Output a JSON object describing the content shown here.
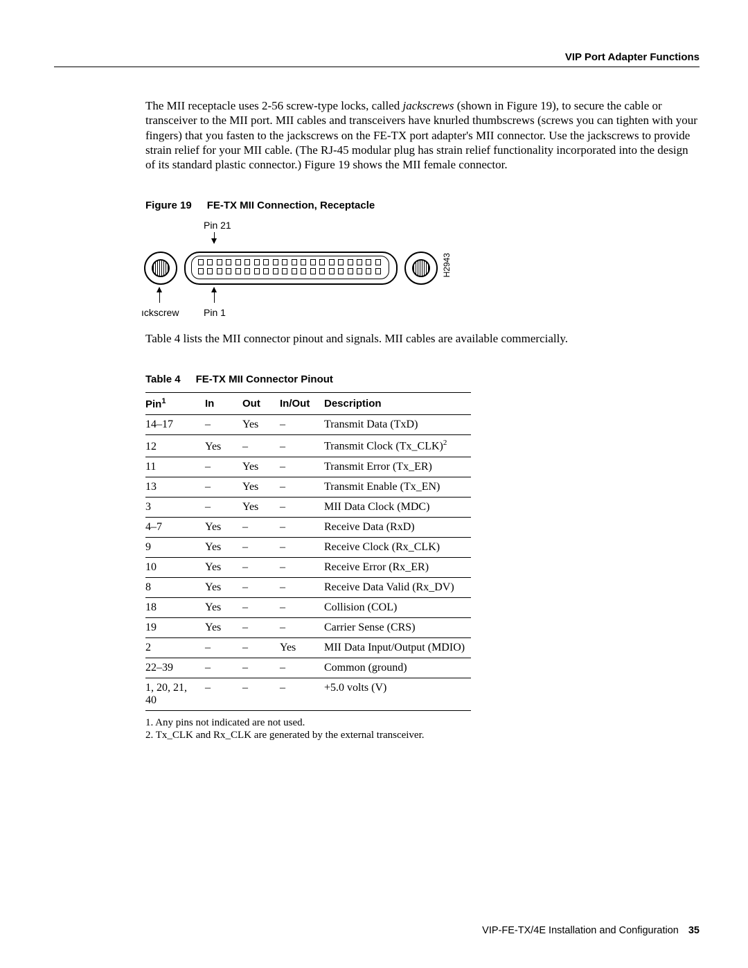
{
  "header": {
    "title": "VIP Port Adapter Functions"
  },
  "paragraphs": {
    "p1a": "The MII receptacle uses 2-56 screw-type locks, called ",
    "p1_jack": "jackscrews",
    "p1b": " (shown in Figure 19), to secure the cable or transceiver to the MII port. MII cables and transceivers have knurled thumbscrews (screws you can tighten with your fingers) that you fasten to the jackscrews on the FE-TX port adapter's MII connector. Use the jackscrews to provide strain relief for your MII cable. (The RJ-45 modular plug has strain relief functionality incorporated into the design of its standard plastic connector.) Figure 19 shows the MII female connector.",
    "p2": "Table 4 lists the MII connector pinout and signals. MII cables are available commercially."
  },
  "figure": {
    "label": "Figure 19",
    "title": "FE-TX MII Connection, Receptacle",
    "pin21": "Pin 21",
    "pin1": "Pin 1",
    "jackscrew": "ıckscrew",
    "code": "H2943"
  },
  "table": {
    "label": "Table 4",
    "title": "FE-TX MII Connector Pinout",
    "headers": {
      "pin": "Pin",
      "pin_sup": "1",
      "in": "In",
      "out": "Out",
      "inout": "In/Out",
      "desc": "Description"
    },
    "rows": [
      {
        "pin": "14–17",
        "in": "–",
        "out": "Yes",
        "inout": "–",
        "desc": "Transmit Data (TxD)"
      },
      {
        "pin": "12",
        "in": "Yes",
        "out": "–",
        "inout": "–",
        "desc": "Transmit Clock (Tx_CLK)",
        "desc_sup": "2"
      },
      {
        "pin": "11",
        "in": "–",
        "out": "Yes",
        "inout": "–",
        "desc": "Transmit Error (Tx_ER)"
      },
      {
        "pin": "13",
        "in": "–",
        "out": "Yes",
        "inout": "–",
        "desc": "Transmit Enable (Tx_EN)"
      },
      {
        "pin": "3",
        "in": "–",
        "out": "Yes",
        "inout": "–",
        "desc": "MII Data Clock (MDC)"
      },
      {
        "pin": "4–7",
        "in": "Yes",
        "out": "–",
        "inout": "–",
        "desc": "Receive Data (RxD)"
      },
      {
        "pin": "9",
        "in": "Yes",
        "out": "–",
        "inout": "–",
        "desc": "Receive Clock (Rx_CLK)"
      },
      {
        "pin": "10",
        "in": "Yes",
        "out": "–",
        "inout": "–",
        "desc": "Receive Error (Rx_ER)"
      },
      {
        "pin": "8",
        "in": "Yes",
        "out": "–",
        "inout": "–",
        "desc": "Receive Data Valid (Rx_DV)"
      },
      {
        "pin": "18",
        "in": "Yes",
        "out": "–",
        "inout": "–",
        "desc": "Collision (COL)"
      },
      {
        "pin": "19",
        "in": "Yes",
        "out": "–",
        "inout": "–",
        "desc": "Carrier Sense (CRS)"
      },
      {
        "pin": "2",
        "in": "–",
        "out": "–",
        "inout": "Yes",
        "desc": "MII Data Input/Output (MDIO)"
      },
      {
        "pin": "22–39",
        "in": "–",
        "out": "–",
        "inout": "–",
        "desc": "Common (ground)"
      },
      {
        "pin": "1, 20, 21, 40",
        "in": "–",
        "out": "–",
        "inout": "–",
        "desc": "+5.0 volts (V)"
      }
    ],
    "footnotes": {
      "f1": "1. Any pins not indicated are not used.",
      "f2": "2. Tx_CLK and Rx_CLK are generated by the external transceiver."
    }
  },
  "footer": {
    "doc": "VIP-FE-TX/4E Installation and Configuration",
    "page": "35"
  }
}
